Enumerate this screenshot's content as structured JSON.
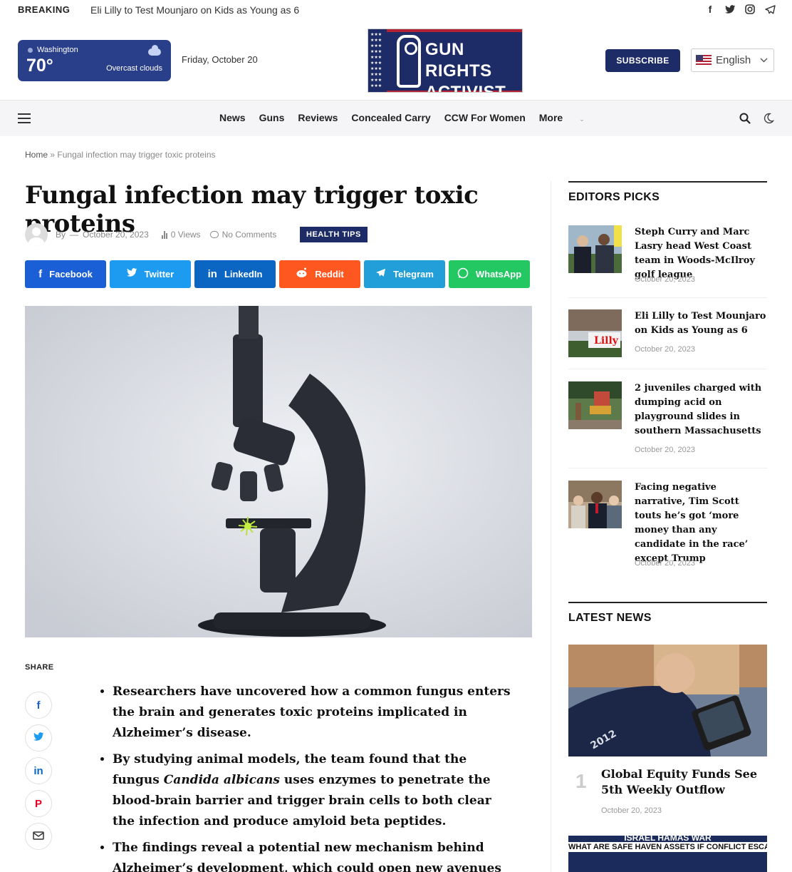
{
  "topbar": {
    "breaking_label": "BREAKING",
    "breaking_text": "Eli Lilly to Test Mounjaro on Kids as Young as 6",
    "social_icons": [
      "facebook-icon",
      "twitter-icon",
      "instagram-icon",
      "telegram-icon"
    ]
  },
  "weather": {
    "location": "Washington",
    "temperature": "70°",
    "condition": "Overcast clouds"
  },
  "header": {
    "date": "Friday, October 20",
    "logo_line1": "GUN RIGHTS",
    "logo_line2": "ACTIVIST",
    "subscribe_label": "SUBSCRIBE",
    "language": "English"
  },
  "nav": {
    "items": [
      "News",
      "Guns",
      "Reviews",
      "Concealed Carry",
      "CCW For Women"
    ],
    "more_label": "More"
  },
  "breadcrumb": {
    "home": "Home",
    "separator": "»",
    "current": "Fungal infection may trigger toxic proteins"
  },
  "article": {
    "title": "Fungal infection may trigger toxic proteins",
    "by_label": "By",
    "dash": "—",
    "date": "October 20, 2023",
    "views": "0 Views",
    "comments": "No Comments",
    "category": "HEALTH TIPS",
    "share_buttons": [
      "Facebook",
      "Twitter",
      "LinkedIn",
      "Reddit",
      "Telegram",
      "WhatsApp"
    ],
    "share_label": "SHARE",
    "bullet1": "Researchers have uncovered how a common fungus enters the brain and generates toxic proteins implicated in Alzheimer’s disease.",
    "bullet2_pre": "By studying animal models, the team found that the fungus ",
    "bullet2_em": "Candida albicans",
    "bullet2_post": " uses enzymes to penetrate the blood-brain barrier and trigger brain cells to both clear the infection and produce amyloid beta peptides.",
    "bullet3": "The findings reveal a potential new mechanism behind Alzheimer’s development, which could open new avenues for novel"
  },
  "sidebar": {
    "editors_title": "EDITORS PICKS",
    "picks": [
      {
        "title": "Steph Curry and Marc Lasry head West Coast team in Woods-McIlroy golf league",
        "date": "October 20, 2023"
      },
      {
        "title": "Eli Lilly to Test Mounjaro on Kids as Young as 6",
        "date": "October 20, 2023"
      },
      {
        "title": "2 juveniles charged with dumping acid on playground slides in southern Massachusetts",
        "date": "October 20, 2023"
      },
      {
        "title": "Facing negative narrative, Tim Scott touts he’s got ‘more money than any candidate in the race’ except Trump",
        "date": "October 20, 2023"
      }
    ],
    "latest_title": "LATEST NEWS",
    "latest": {
      "number": "1",
      "title": "Global Equity Funds See 5th Weekly Outflow",
      "date": "October 20, 2023",
      "image_badge": "2012"
    },
    "latest2_line1": "ISRAEL HAMAS WAR",
    "latest2_line2": "WHAT ARE SAFE HAVEN ASSETS IF CONFLICT ESCALATES"
  },
  "colors": {
    "brand_navy": "#1d2c66",
    "facebook": "#1a5fd6",
    "twitter": "#1d9bf0",
    "linkedin": "#0a66c2",
    "reddit": "#ff5720",
    "telegram": "#229ed9",
    "whatsapp": "#23c862"
  }
}
